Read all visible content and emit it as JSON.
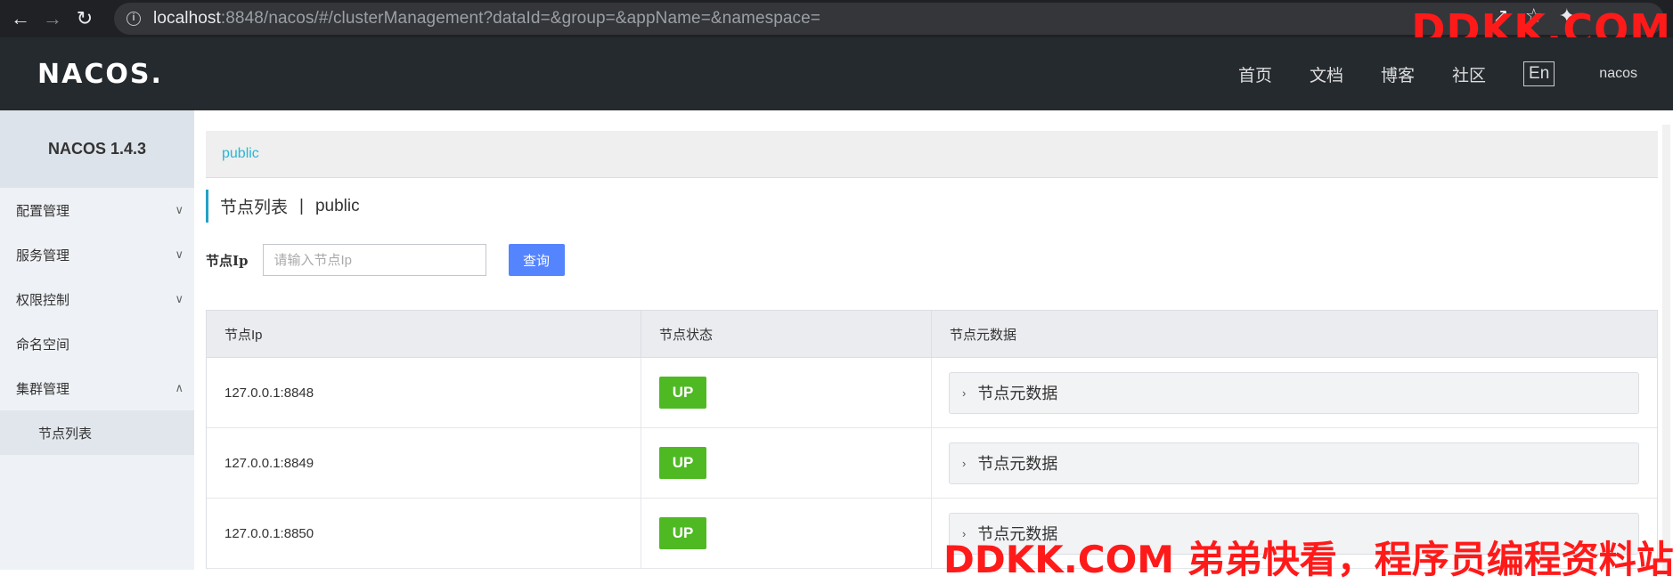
{
  "browser": {
    "url_host": "localhost",
    "url_rest": ":8848/nacos/#/clusterManagement?dataId=&group=&appName=&namespace="
  },
  "watermark": {
    "top": "DDKK.COM",
    "bottom": "DDKK.COM 弟弟快看，程序员编程资料站"
  },
  "header": {
    "logo": "NACOS.",
    "nav": [
      "首页",
      "文档",
      "博客",
      "社区"
    ],
    "lang": "En",
    "user": "nacos"
  },
  "sidebar": {
    "version": "NACOS 1.4.3",
    "items": [
      {
        "label": "配置管理",
        "chevron": "down"
      },
      {
        "label": "服务管理",
        "chevron": "down"
      },
      {
        "label": "权限控制",
        "chevron": "down"
      },
      {
        "label": "命名空间",
        "chevron": ""
      },
      {
        "label": "集群管理",
        "chevron": "up"
      }
    ],
    "sub_item": "节点列表"
  },
  "main": {
    "namespace": "public",
    "title": "节点列表",
    "title_sep": "|",
    "title_ns": "public",
    "search": {
      "label": "节点Ip",
      "placeholder": "请输入节点Ip",
      "button": "查询"
    },
    "table": {
      "columns": [
        "节点Ip",
        "节点状态",
        "节点元数据"
      ],
      "rows": [
        {
          "ip": "127.0.0.1:8848",
          "status": "UP",
          "meta": "节点元数据"
        },
        {
          "ip": "127.0.0.1:8849",
          "status": "UP",
          "meta": "节点元数据"
        },
        {
          "ip": "127.0.0.1:8850",
          "status": "UP",
          "meta": "节点元数据"
        }
      ]
    }
  },
  "colors": {
    "header_bg": "#252a2f",
    "accent": "#22a2c7",
    "primary_button": "#5584ff",
    "status_up": "#4fb923"
  }
}
